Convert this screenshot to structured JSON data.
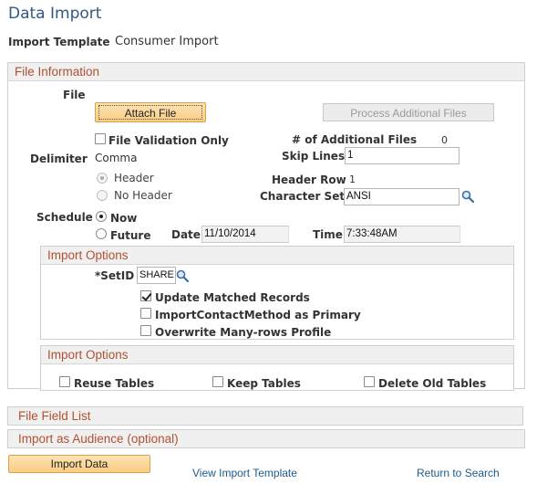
{
  "page": {
    "title": "Data Import",
    "template_label": "Import Template",
    "template_value": "Consumer Import"
  },
  "file_information": {
    "header": "File Information",
    "file_label": "File",
    "attach_button": "Attach File",
    "process_button": "Process Additional Files",
    "file_validation_label": "File Validation Only",
    "additional_files_label": "# of Additional Files",
    "additional_files_value": "0",
    "delimiter_label": "Delimiter",
    "delimiter_value": "Comma",
    "skip_lines_label": "Skip Lines",
    "skip_lines_value": "1",
    "header_option": "Header",
    "no_header_option": "No Header",
    "header_row_label": "Header Row",
    "header_row_value": "1",
    "character_set_label": "Character Set",
    "character_set_value": "ANSI",
    "schedule_label": "Schedule",
    "now_option": "Now",
    "future_option": "Future",
    "date_label": "Date",
    "date_value": "11/10/2014",
    "time_label": "Time",
    "time_value": "7:33:48AM"
  },
  "import_options_1": {
    "header": "Import Options",
    "setid_label": "*SetID",
    "setid_value": "SHARE",
    "update_matched": "Update Matched Records",
    "import_contact": "ImportContactMethod as Primary",
    "overwrite_many": "Overwrite Many-rows Profile"
  },
  "import_options_2": {
    "header": "Import Options",
    "reuse_tables": "Reuse Tables",
    "keep_tables": "Keep Tables",
    "delete_old_tables": "Delete Old Tables"
  },
  "collapsed_sections": {
    "file_field_list": "File Field List",
    "import_as_audience": "Import as Audience (optional)"
  },
  "footer": {
    "import_button": "Import Data",
    "view_template_link": "View Import Template",
    "return_link": "Return to Search"
  },
  "icons": {
    "lookup": "magnifier-icon"
  },
  "colors": {
    "title": "#33597f",
    "section_header": "#b0512f",
    "link": "#1e5a8c",
    "button_orange": "#f9cd85"
  }
}
